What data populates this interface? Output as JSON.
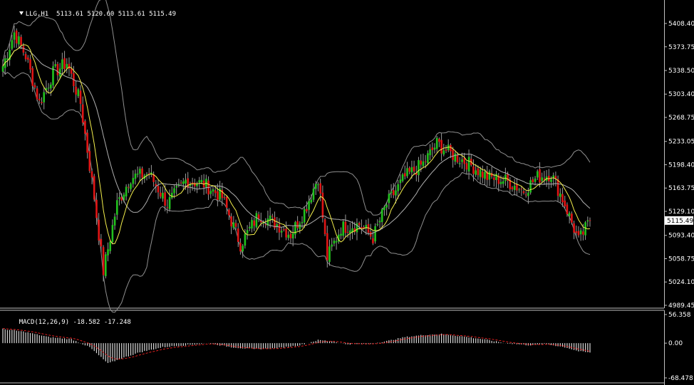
{
  "header": {
    "symbol": "LLG,H1",
    "ohlc": "5113.61 5120.60 5113.61 5115.49"
  },
  "macd_header": {
    "label": "MACD(12,26,9) -18.582 -17.248"
  },
  "colors": {
    "background": "#000000",
    "bull": "#22c21e",
    "bear": "#e01515",
    "wick": "#9a9a9a",
    "bands": "#8f8f8f",
    "ma_fast": "#f5f04c",
    "ma_mid": "#b0b0b0",
    "macd_hist": "#d8d8d8",
    "macd_signal": "#e02020",
    "axis_text": "#ffffff",
    "frame": "#c0c0c0"
  },
  "chart_data": [
    {
      "type": "candlestick",
      "title": "LLG,H1",
      "timeframe": "H1",
      "last_price": 5115.49,
      "y_ticks": [
        "5408.40",
        "5373.75",
        "5338.50",
        "5303.40",
        "5268.75",
        "5233.05",
        "5198.40",
        "5163.75",
        "5129.10",
        "5093.40",
        "5058.75",
        "5024.10",
        "4989.45"
      ],
      "ylim": [
        4989.45,
        5425
      ],
      "grid": false,
      "indicators": [
        "Bollinger Bands",
        "Moving Average"
      ],
      "close_path": [
        {
          "t": 0,
          "price": 5345
        },
        {
          "t": 5,
          "price": 5395
        },
        {
          "t": 10,
          "price": 5360
        },
        {
          "t": 16,
          "price": 5290
        },
        {
          "t": 22,
          "price": 5335
        },
        {
          "t": 28,
          "price": 5350
        },
        {
          "t": 34,
          "price": 5290
        },
        {
          "t": 40,
          "price": 5150
        },
        {
          "t": 44,
          "price": 5040
        },
        {
          "t": 50,
          "price": 5140
        },
        {
          "t": 56,
          "price": 5180
        },
        {
          "t": 64,
          "price": 5185
        },
        {
          "t": 72,
          "price": 5140
        },
        {
          "t": 80,
          "price": 5175
        },
        {
          "t": 88,
          "price": 5170
        },
        {
          "t": 96,
          "price": 5150
        },
        {
          "t": 104,
          "price": 5080
        },
        {
          "t": 112,
          "price": 5125
        },
        {
          "t": 120,
          "price": 5110
        },
        {
          "t": 126,
          "price": 5095
        },
        {
          "t": 132,
          "price": 5130
        },
        {
          "t": 138,
          "price": 5180
        },
        {
          "t": 142,
          "price": 5060
        },
        {
          "t": 148,
          "price": 5105
        },
        {
          "t": 156,
          "price": 5110
        },
        {
          "t": 162,
          "price": 5090
        },
        {
          "t": 168,
          "price": 5140
        },
        {
          "t": 176,
          "price": 5180
        },
        {
          "t": 184,
          "price": 5200
        },
        {
          "t": 190,
          "price": 5230
        },
        {
          "t": 196,
          "price": 5215
        },
        {
          "t": 204,
          "price": 5200
        },
        {
          "t": 212,
          "price": 5180
        },
        {
          "t": 220,
          "price": 5175
        },
        {
          "t": 228,
          "price": 5160
        },
        {
          "t": 234,
          "price": 5180
        },
        {
          "t": 240,
          "price": 5185
        },
        {
          "t": 246,
          "price": 5140
        },
        {
          "t": 252,
          "price": 5085
        },
        {
          "t": 257,
          "price": 5115
        }
      ]
    },
    {
      "type": "bar",
      "title": "MACD(12,26,9)",
      "main_value": -18.582,
      "signal_value": -17.248,
      "y_ticks": [
        "56.358",
        "0.00",
        "-68.478"
      ],
      "ylim": [
        -68.478,
        56.358
      ],
      "series": [
        {
          "name": "MACD",
          "style": "histogram"
        },
        {
          "name": "Signal",
          "style": "dashed-line"
        }
      ],
      "macd_path": [
        {
          "t": 0,
          "value": 28
        },
        {
          "t": 10,
          "value": 22
        },
        {
          "t": 20,
          "value": 12
        },
        {
          "t": 30,
          "value": 8
        },
        {
          "t": 38,
          "value": -8
        },
        {
          "t": 46,
          "value": -40
        },
        {
          "t": 52,
          "value": -30
        },
        {
          "t": 60,
          "value": -18
        },
        {
          "t": 70,
          "value": -8
        },
        {
          "t": 80,
          "value": -4
        },
        {
          "t": 90,
          "value": 0
        },
        {
          "t": 100,
          "value": -8
        },
        {
          "t": 110,
          "value": -12
        },
        {
          "t": 120,
          "value": -10
        },
        {
          "t": 130,
          "value": -4
        },
        {
          "t": 138,
          "value": 6
        },
        {
          "t": 144,
          "value": 4
        },
        {
          "t": 150,
          "value": -2
        },
        {
          "t": 160,
          "value": -2
        },
        {
          "t": 168,
          "value": 4
        },
        {
          "t": 176,
          "value": 12
        },
        {
          "t": 184,
          "value": 16
        },
        {
          "t": 192,
          "value": 18
        },
        {
          "t": 200,
          "value": 14
        },
        {
          "t": 210,
          "value": 8
        },
        {
          "t": 220,
          "value": 0
        },
        {
          "t": 230,
          "value": -4
        },
        {
          "t": 238,
          "value": -2
        },
        {
          "t": 246,
          "value": -8
        },
        {
          "t": 252,
          "value": -16
        },
        {
          "t": 257,
          "value": -18.6
        }
      ]
    }
  ]
}
